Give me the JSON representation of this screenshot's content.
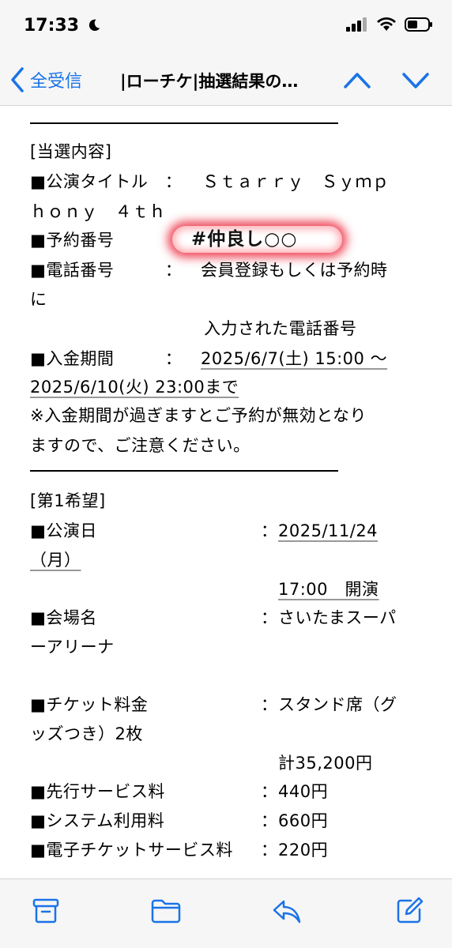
{
  "status": {
    "time": "17:33"
  },
  "nav": {
    "back_label": "全受信",
    "title": "|ローチケ|抽選結果の…"
  },
  "mail": {
    "section1_header": "[当選内容]",
    "title_label": "■公演タイトル　：",
    "title_value_1": "Ｓｔａｒｒｙ　Ｓｙｍｐ",
    "title_value_2": "ｈｏｎｙ　４ｔｈ",
    "reservation_label": "■予約番号",
    "redaction_text": "#仲良し○○",
    "phone_label": "■電話番号　　　：",
    "phone_value_1": "会員登録もしくは予約時",
    "phone_value_2": "に",
    "phone_value_3": "入力された電話番号",
    "payment_label": "■入金期間　　　：",
    "payment_value_1": "2025/6/7(土) 15:00 ～",
    "payment_value_2": "2025/6/10(火) 23:00まで",
    "notice_1": "※入金期間が過ぎますとご予約が無効となり",
    "notice_2": "ますので、ご注意ください。",
    "section2_header": "[第1希望]",
    "date_label": "■公演日",
    "date_value_1": "2025/11/24",
    "date_value_2": "（月）",
    "time_value": "17:00　開演",
    "venue_label": "■会場名",
    "venue_value_1": "さいたまスーパ",
    "venue_value_2": "ーアリーナ",
    "ticket_label": "■チケット料金",
    "ticket_value_1": "スタンド席（グ",
    "ticket_value_2": "ッズつき）2枚",
    "ticket_total": "計35,200円",
    "advance_label": "■先行サービス料",
    "advance_value": "440円",
    "system_label": "■システム利用料",
    "system_value": "660円",
    "eticket_label": "■電子チケットサービス料",
    "eticket_value": "220円",
    "colon": "："
  },
  "colors": {
    "accent": "#1a73e8",
    "redaction": "#eb283c"
  }
}
